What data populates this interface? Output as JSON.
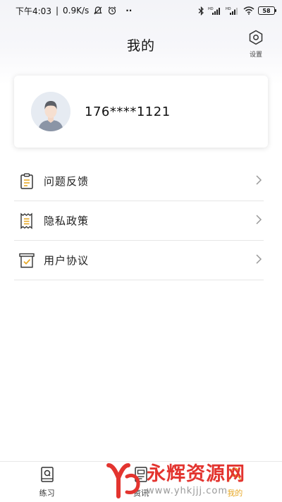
{
  "status_bar": {
    "time": "下午4:03",
    "speed": "0.9K/s",
    "more": "··",
    "battery": "58"
  },
  "header": {
    "title": "我的",
    "settings_label": "设置"
  },
  "profile": {
    "phone": "176****1121"
  },
  "menu": {
    "items": [
      {
        "label": "问题反馈",
        "icon": "feedback-icon"
      },
      {
        "label": "隐私政策",
        "icon": "privacy-policy-icon"
      },
      {
        "label": "用户协议",
        "icon": "user-agreement-icon"
      }
    ]
  },
  "bottom_nav": {
    "items": [
      {
        "label": "练习",
        "icon": "practice-book-icon"
      },
      {
        "label": "资讯",
        "icon": "news-icon"
      },
      {
        "label": "我的",
        "icon": "profile-icon"
      }
    ],
    "active_index": 2
  },
  "watermark": {
    "brand": "永辉资源网",
    "url": "www.yhkjjj.com"
  },
  "colors": {
    "accent": "#e8a928",
    "watermark_red": "#e3342f",
    "text": "#222222"
  }
}
